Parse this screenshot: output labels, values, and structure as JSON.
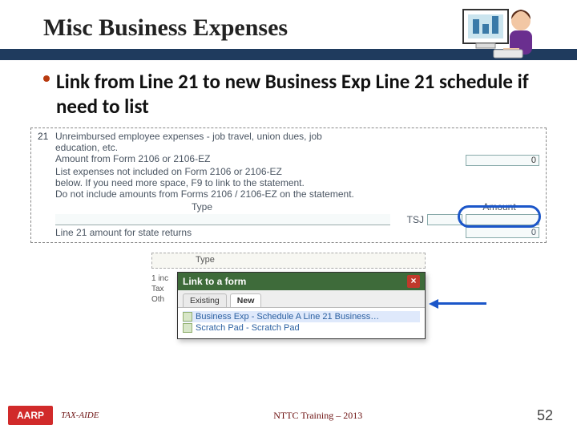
{
  "title": "Misc Business Expenses",
  "bullet": "Link from Line 21 to new Business Exp Line 21 schedule if need to list",
  "form": {
    "line_num": "21",
    "desc1": "Unreimbursed employee expenses - job travel,  union dues,  job",
    "desc2": "education,  etc.",
    "form2106": "Amount from Form 2106 or 2106-EZ",
    "list_instr1": "List expenses not included on Form 2106 or 2106-EZ",
    "list_instr2": "below.  If you need more space,  F9 to link to the statement.",
    "list_instr3": "Do not include amounts from Forms 2106 / 2106-EZ on the statement.",
    "type_hdr": "Type",
    "amount_hdr": "Amount",
    "tsj_label": "TSJ",
    "state_line": "Line 21 amount for state returns",
    "amt_2106": "0",
    "amt_state": "0"
  },
  "popup": {
    "type_label": "Type",
    "left1": "1 inc",
    "left2": "Tax",
    "left3": "Oth",
    "title": "Link to a form",
    "tab_existing": "Existing",
    "tab_new": "New",
    "item1": "Business Exp - Schedule A Line 21 Business…",
    "item2": "Scratch Pad - Scratch Pad"
  },
  "footer": {
    "logo": "AARP",
    "taxaide": "TAX-AIDE",
    "center": "NTTC Training – 2013",
    "page": "52"
  }
}
